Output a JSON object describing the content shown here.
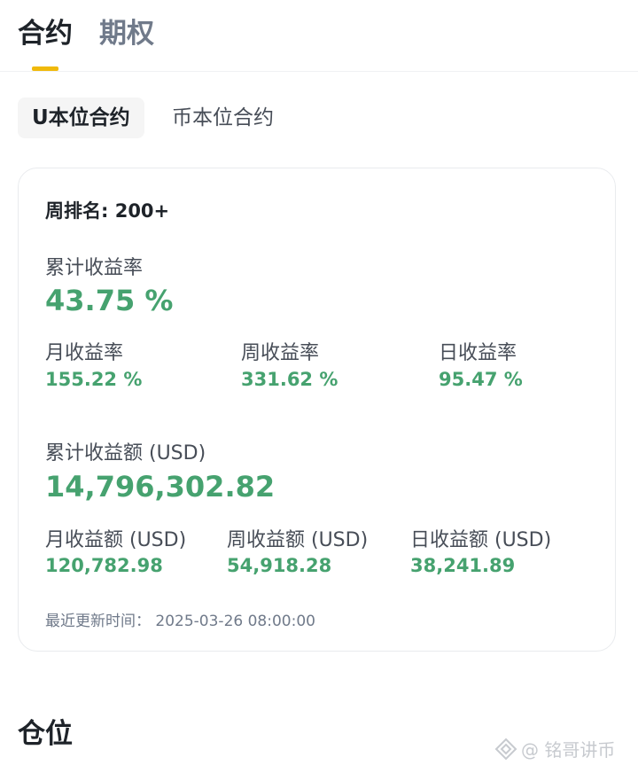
{
  "tabs": {
    "contract": "合约",
    "options": "期权"
  },
  "sub_tabs": {
    "usdm": "U本位合约",
    "coinm": "币本位合约"
  },
  "card": {
    "weekly_rank": "周排名: 200+",
    "total_roi_label": "累计收益率",
    "total_roi_value": "43.75 %",
    "monthly_roi_label": "月收益率",
    "monthly_roi_value": "155.22 %",
    "weekly_roi_label": "周收益率",
    "weekly_roi_value": "331.62 %",
    "daily_roi_label": "日收益率",
    "daily_roi_value": "95.47 %",
    "total_pnl_label": "累计收益额 (USD)",
    "total_pnl_value": "14,796,302.82",
    "monthly_pnl_label": "月收益额 (USD)",
    "monthly_pnl_value": "120,782.98",
    "weekly_pnl_label": "周收益额 (USD)",
    "weekly_pnl_value": "54,918.28",
    "daily_pnl_label": "日收益额 (USD)",
    "daily_pnl_value": "38,241.89",
    "last_updated": "最近更新时间：  2025-03-26 08:00:00"
  },
  "section": {
    "positions": "仓位"
  },
  "watermark": {
    "text": "@ 铭哥讲币"
  },
  "colors": {
    "accent": "#f0b90b",
    "positive": "#46a26f"
  }
}
